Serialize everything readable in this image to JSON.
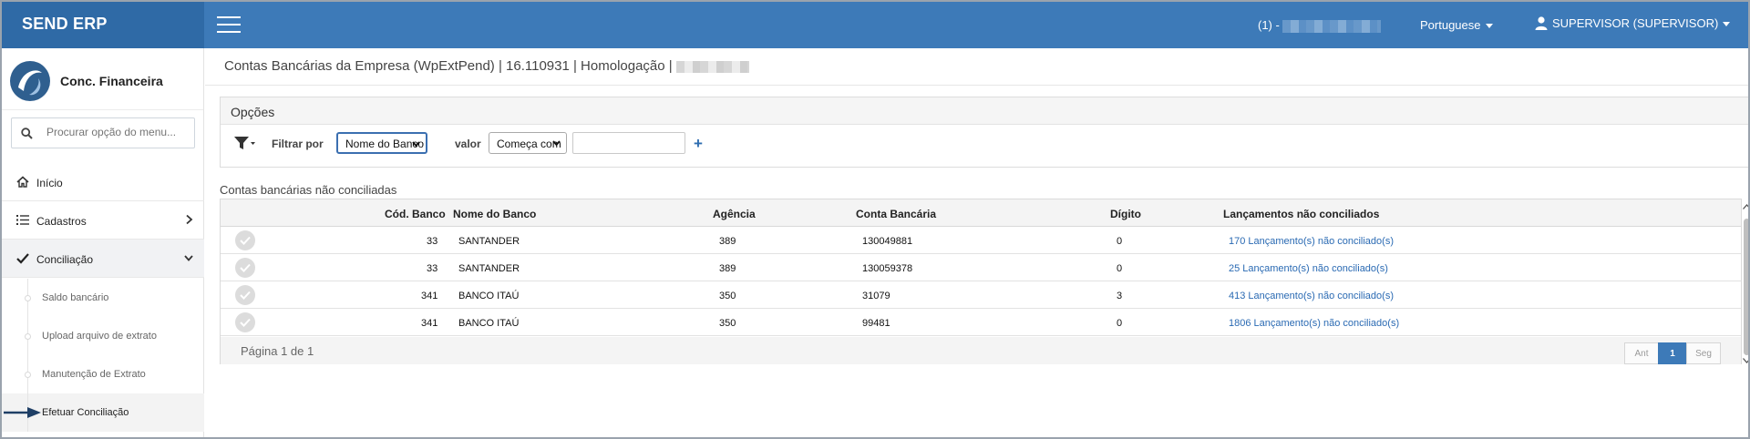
{
  "brand": "SEND ERP",
  "topbar": {
    "company_prefix": "(1) -",
    "language": "Portuguese",
    "user": "SUPERVISOR (SUPERVISOR)"
  },
  "sidebar": {
    "module_title": "Conc. Financeira",
    "search_placeholder": "Procurar opção do menu...",
    "items": [
      {
        "label": "Início",
        "icon": "home-icon"
      },
      {
        "label": "Cadastros",
        "icon": "list-icon"
      },
      {
        "label": "Conciliação",
        "icon": "check-icon"
      }
    ],
    "subitems": [
      {
        "label": "Saldo bancário"
      },
      {
        "label": "Upload arquivo de extrato"
      },
      {
        "label": "Manutenção de Extrato"
      },
      {
        "label": "Efetuar Conciliação"
      }
    ]
  },
  "page": {
    "title": "Contas Bancárias da Empresa (WpExtPend) | 16.110931 | Homologação |",
    "title_suffix": "_"
  },
  "options": {
    "heading": "Opções",
    "filter_label": "Filtrar por",
    "filter_field": "Nome do Banco",
    "value_label": "valor",
    "operator": "Começa com",
    "value": ""
  },
  "grid": {
    "caption": "Contas bancárias não conciliadas",
    "columns": [
      "Cód. Banco",
      "Nome do Banco",
      "Agência",
      "Conta Bancária",
      "Dígito",
      "Lançamentos não conciliados"
    ],
    "rows": [
      {
        "cod": "33",
        "nome": "SANTANDER",
        "agencia": "389",
        "conta": "130049881",
        "digito": "0",
        "lanc": "170 Lançamento(s) não conciliado(s)"
      },
      {
        "cod": "33",
        "nome": "SANTANDER",
        "agencia": "389",
        "conta": "130059378",
        "digito": "0",
        "lanc": "25 Lançamento(s) não conciliado(s)"
      },
      {
        "cod": "341",
        "nome": "BANCO ITAÚ",
        "agencia": "350",
        "conta": "31079",
        "digito": "3",
        "lanc": "413 Lançamento(s) não conciliado(s)"
      },
      {
        "cod": "341",
        "nome": "BANCO ITAÚ",
        "agencia": "350",
        "conta": "99481",
        "digito": "0",
        "lanc": "1806 Lançamento(s) não conciliado(s)"
      }
    ],
    "pager_text": "Página 1 de 1",
    "prev": "Ant",
    "page": "1",
    "next": "Seg"
  },
  "colors": {
    "header_blue": "#3d7ab8",
    "brand_blue": "#2f6aa6",
    "link_blue": "#2a6ab3"
  }
}
